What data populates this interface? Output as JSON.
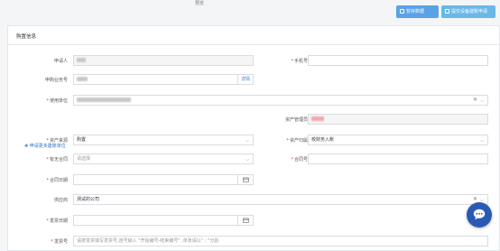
{
  "top_hint": "预览",
  "toolbar": {
    "save_label": "暂存数据",
    "submit_label": "提交设备建账申请"
  },
  "panel": {
    "title": "购置信息"
  },
  "form": {
    "applicant_label": "申请人",
    "phone_label": "手机号",
    "request_no_label": "申购业务号",
    "request_no_addon": "详情",
    "use_unit_label": "使用单位",
    "add_unit_link": "申请更多建账单位",
    "asset_admin_label": "资产管理员",
    "asset_source_label": "资产来源",
    "asset_source_value": "购置",
    "asset_belong_label": "资产归属",
    "asset_belong_value": "校财务入账",
    "has_contract_label": "有无合同",
    "has_contract_placeholder": "请选择",
    "contract_no_label": "合同号",
    "contract_date_label": "合同日期",
    "supplier_label": "供应商",
    "supplier_value": "测试的公司",
    "invoice_date_label": "发票日期",
    "invoice_no_label": "发票号",
    "invoice_no_placeholder": "请按发票填写发票号,连号输入 \"开始编号-结束编号\" ,单张请以\" ; \"分割"
  },
  "colors": {
    "accent": "#5aa2e6",
    "required": "#e2353b",
    "link": "#2f6fc6",
    "chat": "#2a58b5"
  },
  "icons": {
    "dropdown": "chevron-down-icon",
    "calendar": "calendar-icon",
    "clear": "close-icon",
    "chat": "chat-bubble-icon"
  }
}
